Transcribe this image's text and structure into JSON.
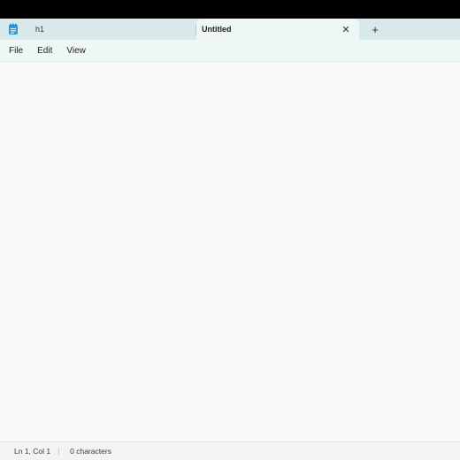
{
  "tabs": [
    {
      "label": "h1",
      "active": false
    },
    {
      "label": "Untitled",
      "active": true
    }
  ],
  "tab_close_glyph": "✕",
  "new_tab_glyph": "+",
  "menu": {
    "items": [
      "File",
      "Edit",
      "View"
    ]
  },
  "editor": {
    "content": ""
  },
  "status": {
    "position": "Ln 1, Col 1",
    "characters": "0 characters"
  },
  "colors": {
    "tabbar": "#d7e9ea",
    "active_tab": "#eef6f6",
    "editor_bg": "#f9f9f9",
    "app_icon": "#2f9bd7"
  },
  "icons": {
    "app": "notepad-icon",
    "close": "close-icon",
    "add": "plus-icon"
  }
}
